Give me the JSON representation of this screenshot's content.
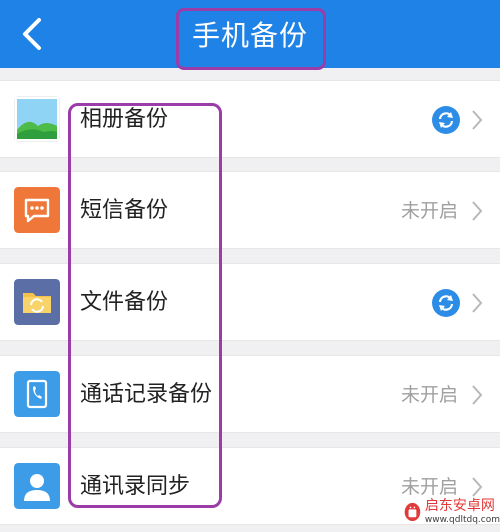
{
  "header": {
    "title": "手机备份",
    "back_icon": "chevron-left-icon"
  },
  "rows": [
    {
      "label": "相册备份",
      "status": "",
      "sync_on": true,
      "icon": "photo-icon",
      "icon_color": "#ffffff"
    },
    {
      "label": "短信备份",
      "status": "未开启",
      "sync_on": false,
      "icon": "message-icon",
      "icon_color": "#f0773a"
    },
    {
      "label": "文件备份",
      "status": "",
      "sync_on": true,
      "icon": "folder-icon",
      "icon_color": "#5b6fa6"
    },
    {
      "label": "通话记录备份",
      "status": "未开启",
      "sync_on": false,
      "icon": "phone-book-icon",
      "icon_color": "#3d9ce8"
    },
    {
      "label": "通讯录同步",
      "status": "未开启",
      "sync_on": false,
      "icon": "contact-icon",
      "icon_color": "#3d9ce8"
    }
  ],
  "colors": {
    "accent": "#1e82e6",
    "highlight": "#9b3ca8",
    "sync_badge": "#2d8de6"
  },
  "watermark": {
    "name": "启东安卓网",
    "url": "www.qdltdq.com"
  }
}
